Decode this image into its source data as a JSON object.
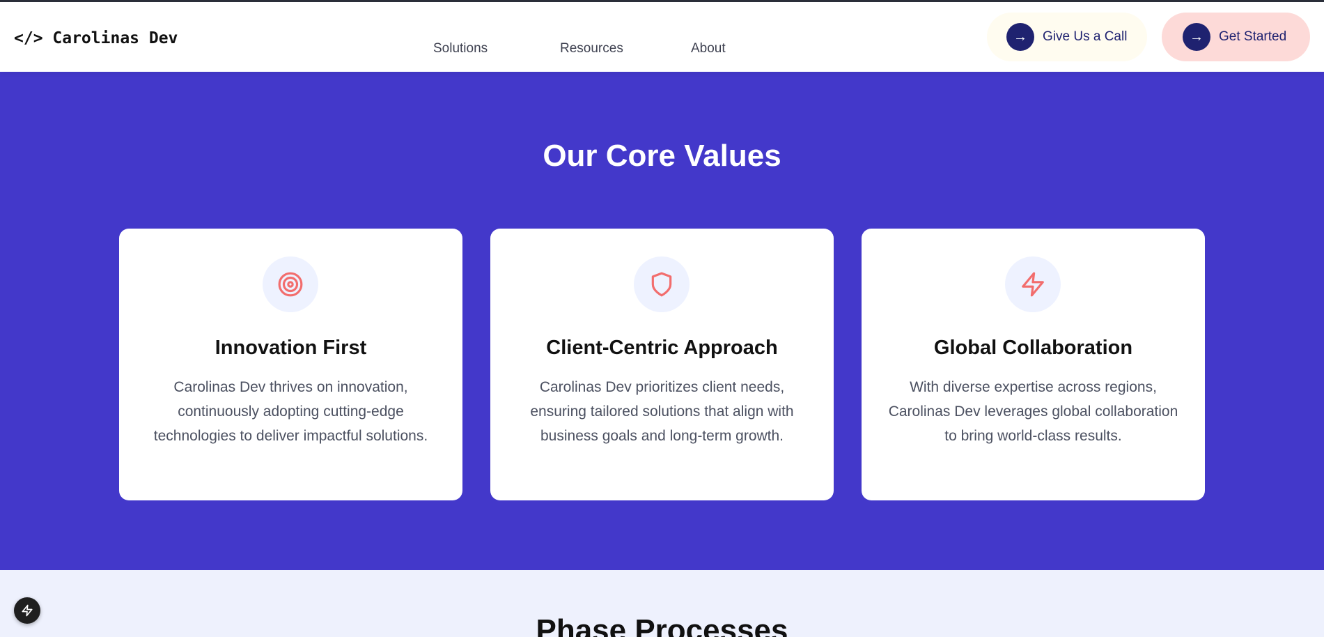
{
  "header": {
    "logo": "</> Carolinas Dev",
    "nav": [
      {
        "label": "Solutions"
      },
      {
        "label": "Resources"
      },
      {
        "label": "About"
      }
    ],
    "call_button": {
      "label": "Give Us a Call",
      "arrow": "→"
    },
    "start_button": {
      "label": "Get Started",
      "arrow": "→"
    }
  },
  "values_section": {
    "title": "Our Core Values",
    "cards": [
      {
        "icon": "target-icon",
        "title": "Innovation First",
        "description": "Carolinas Dev thrives on innovation, continuously adopting cutting-edge technologies to deliver impactful solutions."
      },
      {
        "icon": "shield-icon",
        "title": "Client-Centric Approach",
        "description": "Carolinas Dev prioritizes client needs, ensuring tailored solutions that align with business goals and long-term growth."
      },
      {
        "icon": "lightning-icon",
        "title": "Global Collaboration",
        "description": "With diverse expertise across regions, Carolinas Dev leverages global collaboration to bring world-class results."
      }
    ]
  },
  "phase_section": {
    "title": "Phase Processes"
  },
  "floating_button": {
    "icon": "lightning-icon"
  },
  "colors": {
    "section_bg": "#4338ca",
    "accent_icon": "#f26d6d",
    "button_navy": "#1f2270",
    "get_started_bg": "#fddad8",
    "call_bg": "#fffcf0",
    "phase_bg": "#eef1fd"
  }
}
